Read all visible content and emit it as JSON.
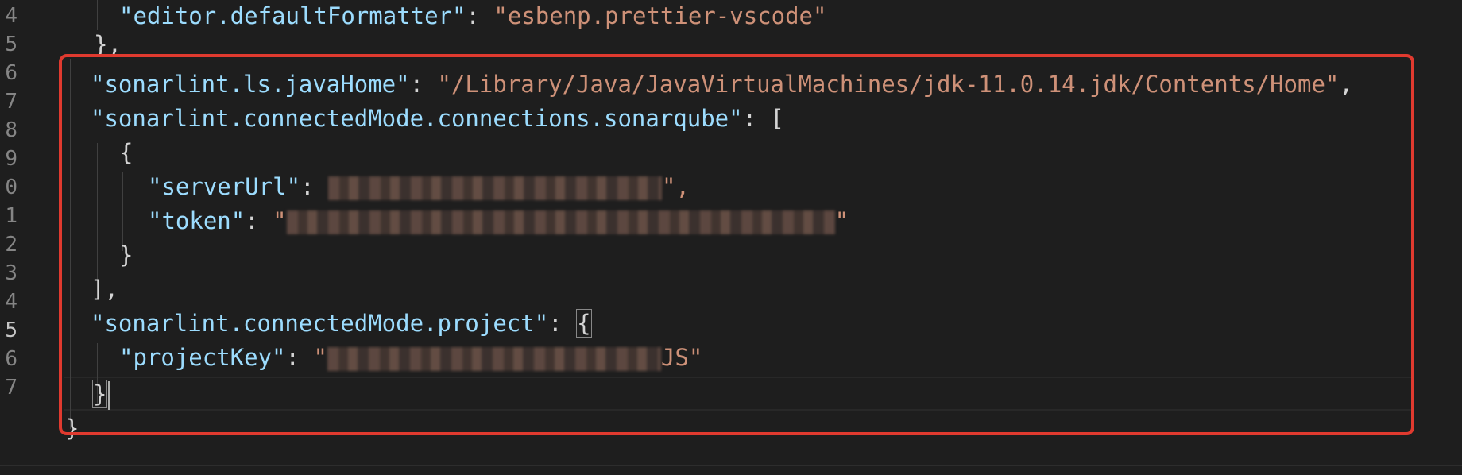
{
  "editor": {
    "line_numbers": [
      "4",
      "5",
      "6",
      "7",
      "8",
      "9",
      "0",
      "1",
      "2",
      "3",
      "4",
      "5",
      "6",
      "7"
    ],
    "lines": {
      "l4_key": "\"editor.defaultFormatter\"",
      "l4_colon": ": ",
      "l4_value": "\"esbenp.prettier-vscode\"",
      "l5_text": "},",
      "l6_key": "\"sonarlint.ls.javaHome\"",
      "l6_colon": ": ",
      "l6_value": "\"/Library/Java/JavaVirtualMachines/jdk-11.0.14.jdk/Contents/Home\"",
      "l6_comma": ",",
      "l7_key": "\"sonarlint.connectedMode.connections.sonarqube\"",
      "l7_rest": ": [",
      "l8_text": "{",
      "l9_key": "\"serverUrl\"",
      "l9_colon": ": ",
      "l9_end": "\",",
      "l10_key": "\"token\"",
      "l10_colon": ": ",
      "l10_start": "\"",
      "l10_end": "\"",
      "l11_text": "}",
      "l12_text": "],",
      "l13_key": "\"sonarlint.connectedMode.project\"",
      "l13_colon": ": ",
      "l13_brace": "{",
      "l14_key": "\"projectKey\"",
      "l14_colon": ": ",
      "l14_start": "\"",
      "l14_end": "JS\"",
      "l15_brace": "}",
      "l16_text": "}"
    }
  },
  "colors": {
    "background": "#1e1e1e",
    "key": "#9cdcfe",
    "string": "#ce9178",
    "highlight_border": "#e03a2f"
  }
}
